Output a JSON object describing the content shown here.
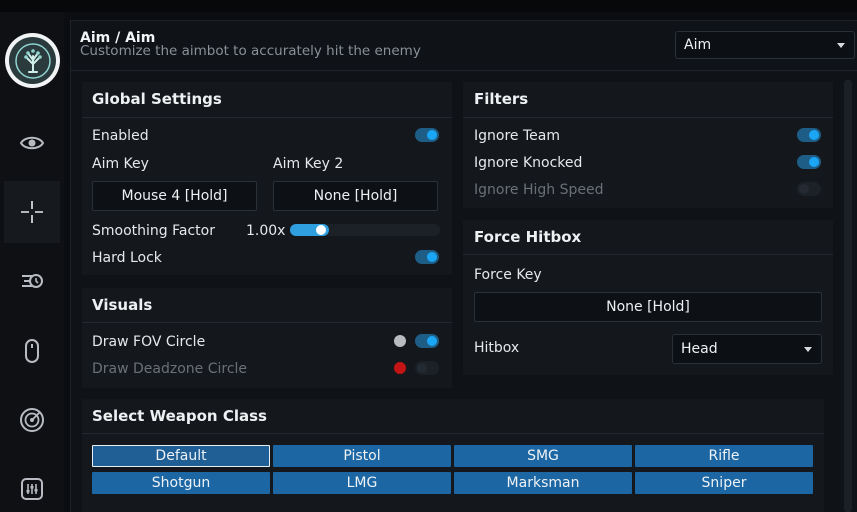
{
  "header": {
    "title": "Aim / Aim",
    "subtitle": "Customize the aimbot to accurately hit the enemy",
    "category_select": "Aim"
  },
  "sidebar": {
    "items": [
      {
        "icon": "eye-icon"
      },
      {
        "icon": "crosshair-icon",
        "active": true
      },
      {
        "icon": "speed-icon"
      },
      {
        "icon": "mouse-icon"
      },
      {
        "icon": "radar-icon"
      },
      {
        "icon": "sliders-icon"
      }
    ]
  },
  "global_settings": {
    "title": "Global Settings",
    "enabled_label": "Enabled",
    "enabled": true,
    "aim_key_label": "Aim Key",
    "aim_key_value": "Mouse 4 [Hold]",
    "aim_key2_label": "Aim Key 2",
    "aim_key2_value": "None [Hold]",
    "smoothing_label": "Smoothing Factor",
    "smoothing_value": "1.00x",
    "smoothing_fraction": 0.26,
    "hard_lock_label": "Hard Lock",
    "hard_lock": true
  },
  "visuals": {
    "title": "Visuals",
    "fov_label": "Draw FOV Circle",
    "fov_color": "#b9bcbf",
    "fov_enabled": true,
    "deadzone_label": "Draw Deadzone Circle",
    "deadzone_color": "#c41414",
    "deadzone_enabled": false
  },
  "filters": {
    "title": "Filters",
    "ignore_team_label": "Ignore Team",
    "ignore_team": true,
    "ignore_knocked_label": "Ignore Knocked",
    "ignore_knocked": true,
    "ignore_speed_label": "Ignore High Speed",
    "ignore_speed": false
  },
  "force_hitbox": {
    "title": "Force Hitbox",
    "force_key_label": "Force Key",
    "force_key_value": "None [Hold]",
    "hitbox_label": "Hitbox",
    "hitbox_value": "Head"
  },
  "weapon_class": {
    "title": "Select Weapon Class",
    "buttons": [
      "Default",
      "Pistol",
      "SMG",
      "Rifle",
      "Shotgun",
      "LMG",
      "Marksman",
      "Sniper"
    ],
    "selected": "Default"
  },
  "colors": {
    "accent": "#1aa6f5",
    "weapon_button": "#1b66a3"
  }
}
